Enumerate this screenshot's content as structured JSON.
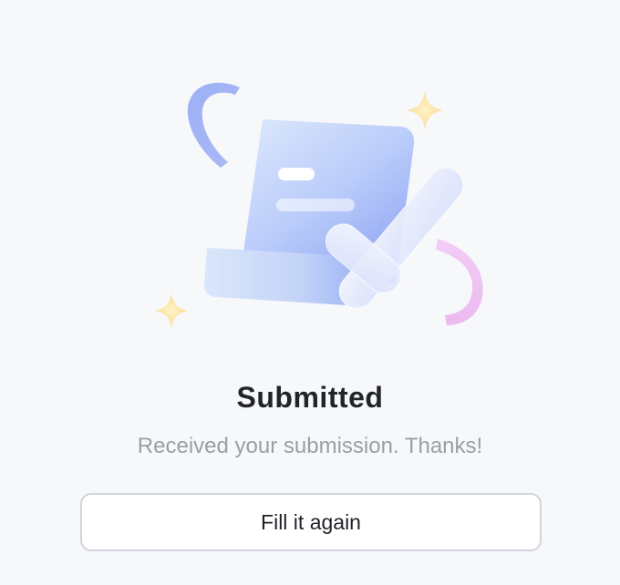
{
  "status": {
    "title": "Submitted",
    "message": "Received your submission. Thanks!"
  },
  "actions": {
    "fill_again_label": "Fill it again"
  },
  "colors": {
    "page_background": "#f7f8fa",
    "title_text": "#222428",
    "message_text": "#9a9ea6",
    "button_border": "#d2d5db",
    "illustration_blue": "#8ea6f5",
    "sparkle_yellow": "#fbe3a3",
    "ribbon_pink": "#f0c4f4"
  },
  "icons": {
    "illustration": "submitted-document-check-icon"
  }
}
